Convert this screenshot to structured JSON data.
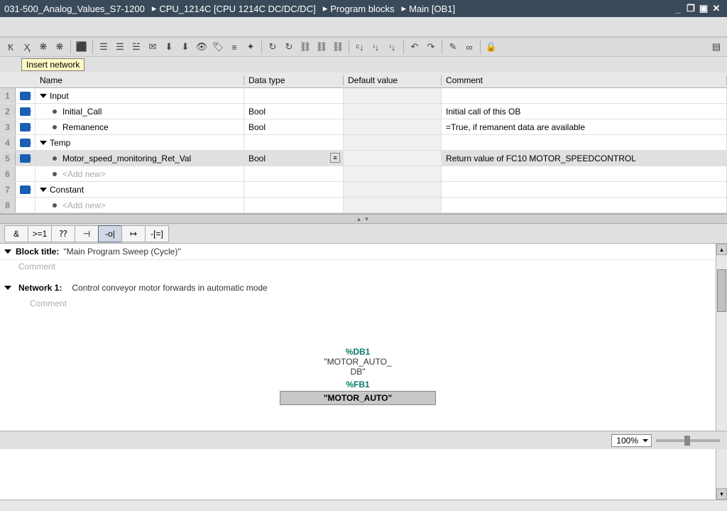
{
  "titlebar": {
    "crumbs": [
      "031-500_Analog_Values_S7-1200",
      "CPU_1214C [CPU 1214C DC/DC/DC]",
      "Program blocks",
      "Main [OB1]"
    ],
    "sep": "▸"
  },
  "tooltip": "Insert network",
  "main_label": "Main",
  "iface": {
    "headers": {
      "name": "Name",
      "type": "Data type",
      "default": "Default value",
      "comment": "Comment"
    },
    "rows": [
      {
        "n": "1",
        "kind": "section",
        "name": "Input",
        "type": "",
        "default": "",
        "comment": ""
      },
      {
        "n": "2",
        "kind": "var",
        "name": "Initial_Call",
        "type": "Bool",
        "default": "",
        "comment": "Initial call of this OB"
      },
      {
        "n": "3",
        "kind": "var",
        "name": "Remanence",
        "type": "Bool",
        "default": "",
        "comment": "=True, if remanent data are available"
      },
      {
        "n": "4",
        "kind": "section",
        "name": "Temp",
        "type": "",
        "default": "",
        "comment": ""
      },
      {
        "n": "5",
        "kind": "var",
        "name": "Motor_speed_monitoring_Ret_Val",
        "type": "Bool",
        "default": "",
        "comment": "Return value of FC10 MOTOR_SPEEDCONTROL",
        "selected": true,
        "pick": true
      },
      {
        "n": "6",
        "kind": "add",
        "name": "<Add new>",
        "type": "",
        "default": "",
        "comment": ""
      },
      {
        "n": "7",
        "kind": "section",
        "name": "Constant",
        "type": "",
        "default": "",
        "comment": ""
      },
      {
        "n": "8",
        "kind": "add",
        "name": "<Add new>",
        "type": "",
        "default": "",
        "comment": ""
      }
    ]
  },
  "ptool": {
    "items": [
      "&",
      ">=1",
      "⁇",
      "⊣",
      "-o|",
      "↦",
      "-[=]"
    ],
    "active": 4
  },
  "editor": {
    "blocktitle_label": "Block title:",
    "blocktitle_value": "\"Main Program Sweep (Cycle)\"",
    "comment_placeholder": "Comment",
    "network_label": "Network 1:",
    "network_desc": "Control conveyor motor forwards in automatic mode",
    "db_sym": "%DB1",
    "db_name": "\"MOTOR_AUTO_\nDB\"",
    "fb_sym": "%FB1",
    "fb_name": "\"MOTOR_AUTO\""
  },
  "footer": {
    "zoom": "100%"
  }
}
